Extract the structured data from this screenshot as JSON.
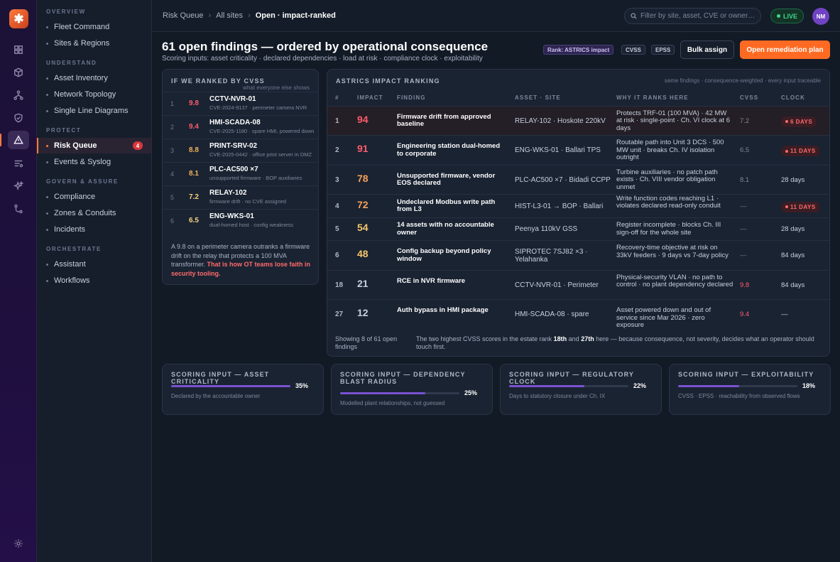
{
  "app": {
    "logo_glyph": "✱"
  },
  "nav": {
    "sections": {
      "overview": "OVERVIEW",
      "understand": "UNDERSTAND",
      "protect": "PROTECT",
      "govern": "GOVERN & ASSURE",
      "orchestrate": "ORCHESTRATE"
    },
    "items": {
      "fleet": "Fleet Command",
      "sites": "Sites & Regions",
      "inventory": "Asset Inventory",
      "topology": "Network Topology",
      "sld": "Single Line Diagrams",
      "risk": "Risk Queue",
      "risk_badge": "4",
      "events": "Events & Syslog",
      "compliance": "Compliance",
      "zones": "Zones & Conduits",
      "incidents": "Incidents",
      "assistant": "Assistant",
      "workflows": "Workflows"
    }
  },
  "topbar": {
    "crumb1": "Risk Queue",
    "crumb2": "All sites",
    "crumb3": "Open · impact-ranked",
    "search_placeholder": "Filter by site, asset, CVE or owner…",
    "live": "LIVE",
    "avatar": "NM"
  },
  "header": {
    "title": "61 open findings — ordered by operational consequence",
    "subtitle": "Scoring inputs: asset criticality · declared dependencies · load at risk · compliance clock · exploitability",
    "chip_rank": "Rank: ASTRICS impact",
    "chip_cvss": "CVSS",
    "chip_epss": "EPSS",
    "bulk": "Bulk assign",
    "open_plan": "Open remediation plan"
  },
  "cvss_panel": {
    "title": "IF WE RANKED BY CVSS",
    "sub": "what everyone else shows",
    "rows": [
      {
        "idx": "1",
        "score": "9.8",
        "name": "CCTV-NVR-01",
        "desc": "CVE-2024-9137 · perimeter camera NVR"
      },
      {
        "idx": "2",
        "score": "9.4",
        "name": "HMI-SCADA-08",
        "desc": "CVE-2025-1180 · spare HMI, powered down"
      },
      {
        "idx": "3",
        "score": "8.8",
        "name": "PRINT-SRV-02",
        "desc": "CVE-2025-0442 · office print server in DMZ"
      },
      {
        "idx": "4",
        "score": "8.1",
        "name": "PLC-AC500 ×7",
        "desc": "unsupported firmware · BOP auxiliaries"
      },
      {
        "idx": "5",
        "score": "7.2",
        "name": "RELAY-102",
        "desc": "firmware drift · no CVE assigned"
      },
      {
        "idx": "6",
        "score": "6.5",
        "name": "ENG-WKS-01",
        "desc": "dual-homed host · config weakness"
      }
    ],
    "note": "A 9.8 on a perimeter camera outranks a firmware drift on the relay that protects a 100 MVA transformer.",
    "note_hl": "That is how OT teams lose faith in security tooling."
  },
  "ranking": {
    "title": "ASTRICS IMPACT RANKING",
    "sub": "same findings · consequence-weighted · every input traceable",
    "cols": {
      "idx": "#",
      "impact": "IMPACT",
      "finding": "FINDING",
      "asset": "ASSET · SITE",
      "why": "WHY IT RANKS HERE",
      "cvss": "CVSS",
      "clock": "CLOCK"
    },
    "rows": [
      {
        "idx": "1",
        "impact": "94",
        "finding": "Firmware drift from approved baseline",
        "asset": "RELAY-102 · Hoskote 220kV",
        "why": "Protects TRF-01 (100 MVA) · 42 MW at risk · single-point · Ch. VI clock at 6 days",
        "cvss": "7.2",
        "clock": "6 DAYS",
        "clock_urgent": true
      },
      {
        "idx": "2",
        "impact": "91",
        "finding": "Engineering station dual-homed to corporate",
        "asset": "ENG-WKS-01 · Ballari TPS",
        "why": "Routable path into Unit 3 DCS · 500 MW unit · breaks Ch. IV isolation outright",
        "cvss": "6.5",
        "clock": "11 DAYS",
        "clock_urgent": true
      },
      {
        "idx": "3",
        "impact": "78",
        "finding": "Unsupported firmware, vendor EOS declared",
        "asset": "PLC-AC500 ×7 · Bidadi CCPP",
        "why": "Turbine auxiliaries · no patch path exists · Ch. VIII vendor obligation unmet",
        "cvss": "8.1",
        "clock": "28 days",
        "clock_urgent": false
      },
      {
        "idx": "4",
        "impact": "72",
        "finding": "Undeclared Modbus write path from L3",
        "asset": "HIST-L3-01 → BOP · Ballari",
        "why": "Write function codes reaching L1 · violates declared read-only conduit",
        "cvss": "—",
        "clock": "11 DAYS",
        "clock_urgent": true
      },
      {
        "idx": "5",
        "impact": "54",
        "finding": "14 assets with no accountable owner",
        "asset": "Peenya 110kV GSS",
        "why": "Register incomplete · blocks Ch. III sign-off for the whole site",
        "cvss": "—",
        "clock": "28 days",
        "clock_urgent": false
      },
      {
        "idx": "6",
        "impact": "48",
        "finding": "Config backup beyond policy window",
        "asset": "SIPROTEC 7SJ82 ×3 · Yelahanka",
        "why": "Recovery-time objective at risk on 33kV feeders · 9 days vs 7-day policy",
        "cvss": "—",
        "clock": "84 days",
        "clock_urgent": false
      },
      {
        "idx": "18",
        "impact": "21",
        "finding": "RCE in NVR firmware",
        "asset": "CCTV-NVR-01 · Perimeter",
        "why": "Physical-security VLAN · no path to control · no plant dependency declared",
        "cvss": "9.8",
        "clock": "84 days",
        "clock_urgent": false
      },
      {
        "idx": "27",
        "impact": "12",
        "finding": "Auth bypass in HMI package",
        "asset": "HMI-SCADA-08 · spare",
        "why": "Asset powered down and out of service since Mar 2026 · zero exposure",
        "cvss": "9.4",
        "clock": "—",
        "clock_urgent": false
      }
    ],
    "foot_left": "Showing 8 of 61 open findings",
    "foot_a": "The two highest CVSS scores in the estate rank",
    "foot_b": "18th",
    "foot_c": "and",
    "foot_d": "27th",
    "foot_e": "here — because consequence, not severity, decides what an operator should touch first."
  },
  "scoring": [
    {
      "title": "SCORING INPUT — ASSET CRITICALITY",
      "pct": "35%",
      "value": 0.35,
      "note": "Declared by the accountable owner"
    },
    {
      "title": "SCORING INPUT — DEPENDENCY BLAST RADIUS",
      "pct": "25%",
      "value": 0.25,
      "note": "Modelled plant relationships, not guessed"
    },
    {
      "title": "SCORING INPUT — REGULATORY CLOCK",
      "pct": "22%",
      "value": 0.22,
      "note": "Days to statutory closure under Ch. IX"
    },
    {
      "title": "SCORING INPUT — EXPLOITABILITY",
      "pct": "18%",
      "value": 0.18,
      "note": "CVSS · EPSS · reachability from observed flows"
    }
  ],
  "colors": {
    "accent": "#ff6a22",
    "impact_high": "#ff5c6c",
    "impact_mid": "#f5c66b",
    "urgent": "#ff6b6b",
    "bar": "#7a52d1"
  }
}
